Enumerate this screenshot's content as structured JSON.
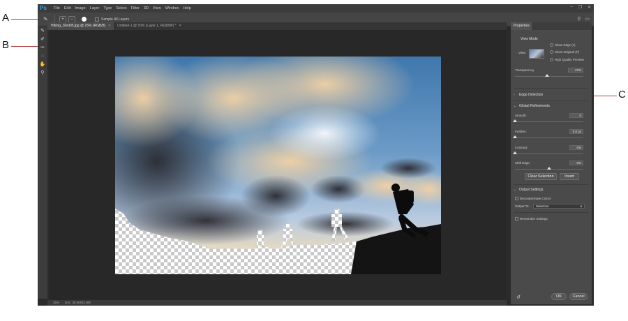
{
  "callouts": {
    "a": "A",
    "b": "B",
    "c": "C"
  },
  "menubar": {
    "logo": "Ps",
    "items": [
      "File",
      "Edit",
      "Image",
      "Layer",
      "Type",
      "Select",
      "Filter",
      "3D",
      "View",
      "Window",
      "Help"
    ],
    "controls": [
      "–",
      "❐",
      "✕"
    ]
  },
  "options": {
    "sample_all_layers": "Sample All Layers"
  },
  "tabs": [
    {
      "label": "Hiking_Shot05.jpg @ 25% (RGB/8)",
      "active": true
    },
    {
      "label": "Untitled-1 @ 50% (Layer 1, RGB/8#) *",
      "active": false
    }
  ],
  "status": {
    "zoom": "25%",
    "doc": "Doc: 36.6M/41.9M"
  },
  "properties": {
    "tab": "Properties",
    "view_mode": {
      "title": "View Mode",
      "view_label": "View:",
      "show_edge": "Show Edge (J)",
      "show_original": "Show Original (P)",
      "high_quality": "High Quality Preview"
    },
    "transparency": {
      "label": "Transparency",
      "value": "47%",
      "level": 0.47
    },
    "edge_detection": "Edge Detection",
    "global_refinements": {
      "title": "Global Refinements",
      "smooth": {
        "label": "Smooth:",
        "value": "0",
        "level": 0.0
      },
      "feather": {
        "label": "Feather:",
        "value": "0.0 px",
        "level": 0.0
      },
      "contrast": {
        "label": "Contrast:",
        "value": "0%",
        "level": 0.0
      },
      "shift_edge": {
        "label": "Shift Edge:",
        "value": "0%",
        "level": 0.5
      }
    },
    "clear_selection": "Clear Selection",
    "invert": "Invert",
    "output_settings": {
      "title": "Output Settings",
      "decontaminate": "Decontaminate Colors",
      "output_to_label": "Output To:",
      "output_to_value": "Selection"
    },
    "remember_settings": "Remember Settings",
    "ok": "OK",
    "cancel": "Cancel"
  }
}
